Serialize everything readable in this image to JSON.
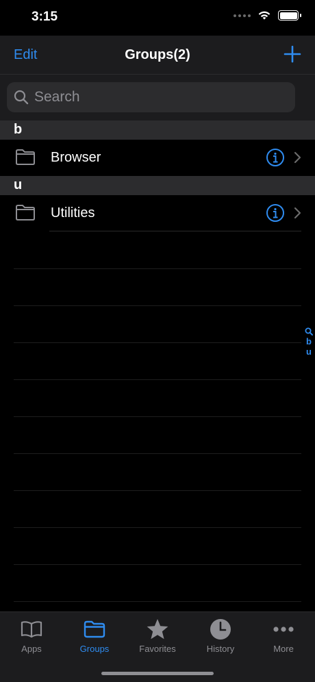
{
  "status": {
    "time": "3:15"
  },
  "nav": {
    "edit_label": "Edit",
    "title": "Groups(2)",
    "add_icon": "plus-icon"
  },
  "search": {
    "placeholder": "Search"
  },
  "sections": [
    {
      "letter": "b",
      "items": [
        {
          "label": "Browser"
        }
      ]
    },
    {
      "letter": "u",
      "items": [
        {
          "label": "Utilities"
        }
      ]
    }
  ],
  "index": [
    "search-icon",
    "b",
    "u"
  ],
  "index_letters": {
    "b": "b",
    "u": "u"
  },
  "tabs": [
    {
      "label": "Apps",
      "icon": "book-icon",
      "active": false
    },
    {
      "label": "Groups",
      "icon": "folder-icon",
      "active": true
    },
    {
      "label": "Favorites",
      "icon": "star-icon",
      "active": false
    },
    {
      "label": "History",
      "icon": "clock-icon",
      "active": false
    },
    {
      "label": "More",
      "icon": "ellipsis-icon",
      "active": false
    }
  ],
  "colors": {
    "accent": "#2f8cf0",
    "background": "#000000",
    "bar": "#1c1c1e",
    "section": "#2c2c2e",
    "inactive": "#8e8e93"
  }
}
